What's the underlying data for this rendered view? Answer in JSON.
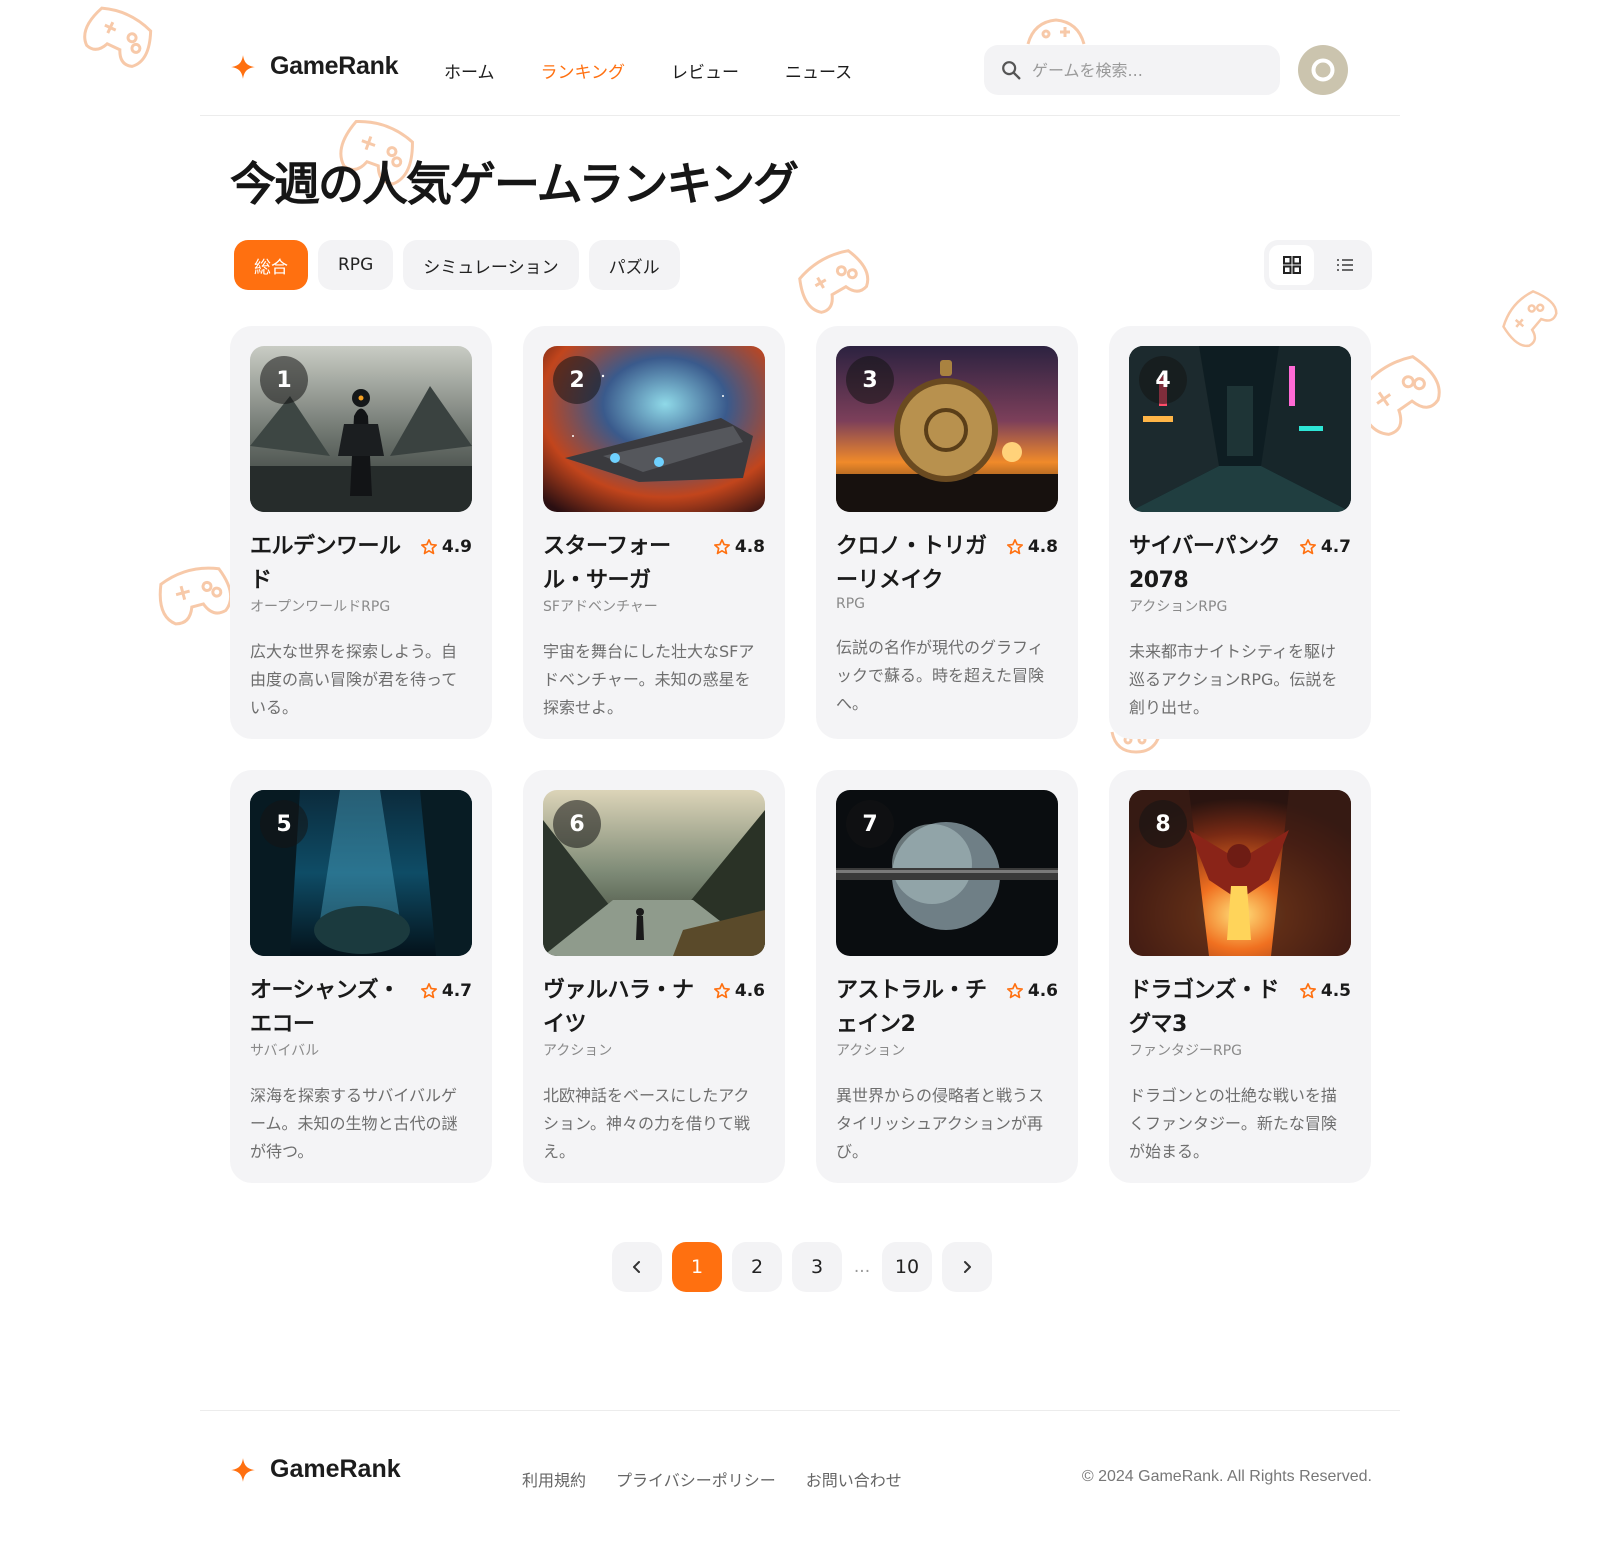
{
  "brand": {
    "name": "GameRank"
  },
  "nav": [
    {
      "label": "ホーム",
      "active": false
    },
    {
      "label": "ランキング",
      "active": true
    },
    {
      "label": "レビュー",
      "active": false
    },
    {
      "label": "ニュース",
      "active": false
    }
  ],
  "search": {
    "placeholder": "ゲームを検索..."
  },
  "page": {
    "title": "今週の人気ゲームランキング"
  },
  "filters": [
    {
      "label": "総合",
      "active": true
    },
    {
      "label": "RPG",
      "active": false
    },
    {
      "label": "シミュレーション",
      "active": false
    },
    {
      "label": "パズル",
      "active": false
    }
  ],
  "view": {
    "selected": "grid"
  },
  "games": [
    {
      "rank": "1",
      "title": "エルデンワールド",
      "rating": "4.9",
      "genre": "オープンワールドRPG",
      "description": "広大な世界を探索しよう。自由度の高い冒険が君を待っている。"
    },
    {
      "rank": "2",
      "title": "スターフォール・サーガ",
      "rating": "4.8",
      "genre": "SFアドベンチャー",
      "description": "宇宙を舞台にした壮大なSFアドベンチャー。未知の惑星を探索せよ。"
    },
    {
      "rank": "3",
      "title": "クロノ・トリガーリメイク",
      "rating": "4.8",
      "genre": "RPG",
      "description": "伝説の名作が現代のグラフィックで蘇る。時を超えた冒険へ。"
    },
    {
      "rank": "4",
      "title": "サイバーパンク2078",
      "rating": "4.7",
      "genre": "アクションRPG",
      "description": "未来都市ナイトシティを駆け巡るアクションRPG。伝説を創り出せ。"
    },
    {
      "rank": "5",
      "title": "オーシャンズ・エコー",
      "rating": "4.7",
      "genre": "サバイバル",
      "description": "深海を探索するサバイバルゲーム。未知の生物と古代の謎が待つ。"
    },
    {
      "rank": "6",
      "title": "ヴァルハラ・ナイツ",
      "rating": "4.6",
      "genre": "アクション",
      "description": "北欧神話をベースにしたアクション。神々の力を借りて戦え。"
    },
    {
      "rank": "7",
      "title": "アストラル・チェイン2",
      "rating": "4.6",
      "genre": "アクション",
      "description": "異世界からの侵略者と戦うスタイリッシュアクションが再び。"
    },
    {
      "rank": "8",
      "title": "ドラゴンズ・ドグマ3",
      "rating": "4.5",
      "genre": "ファンタジーRPG",
      "description": "ドラゴンとの壮絶な戦いを描くファンタジー。新たな冒険が始まる。"
    }
  ],
  "pagination": {
    "pages": [
      "1",
      "2",
      "3"
    ],
    "ellipsis": "...",
    "last": "10",
    "current": "1"
  },
  "footer": {
    "links": [
      "利用規約",
      "プライバシーポリシー",
      "お問い合わせ"
    ],
    "copyright": "© 2024 GameRank. All Rights Reserved."
  },
  "colors": {
    "accent": "#ff7010",
    "card": "#f4f4f6",
    "chip": "#f3f3f5"
  },
  "icons": {
    "brand": "sparkle-icon",
    "search": "search-icon",
    "avatar": "ring-icon",
    "grid": "grid-icon",
    "list": "list-icon",
    "rating": "star-icon",
    "prev": "chevron-left-icon",
    "next": "chevron-right-icon"
  }
}
